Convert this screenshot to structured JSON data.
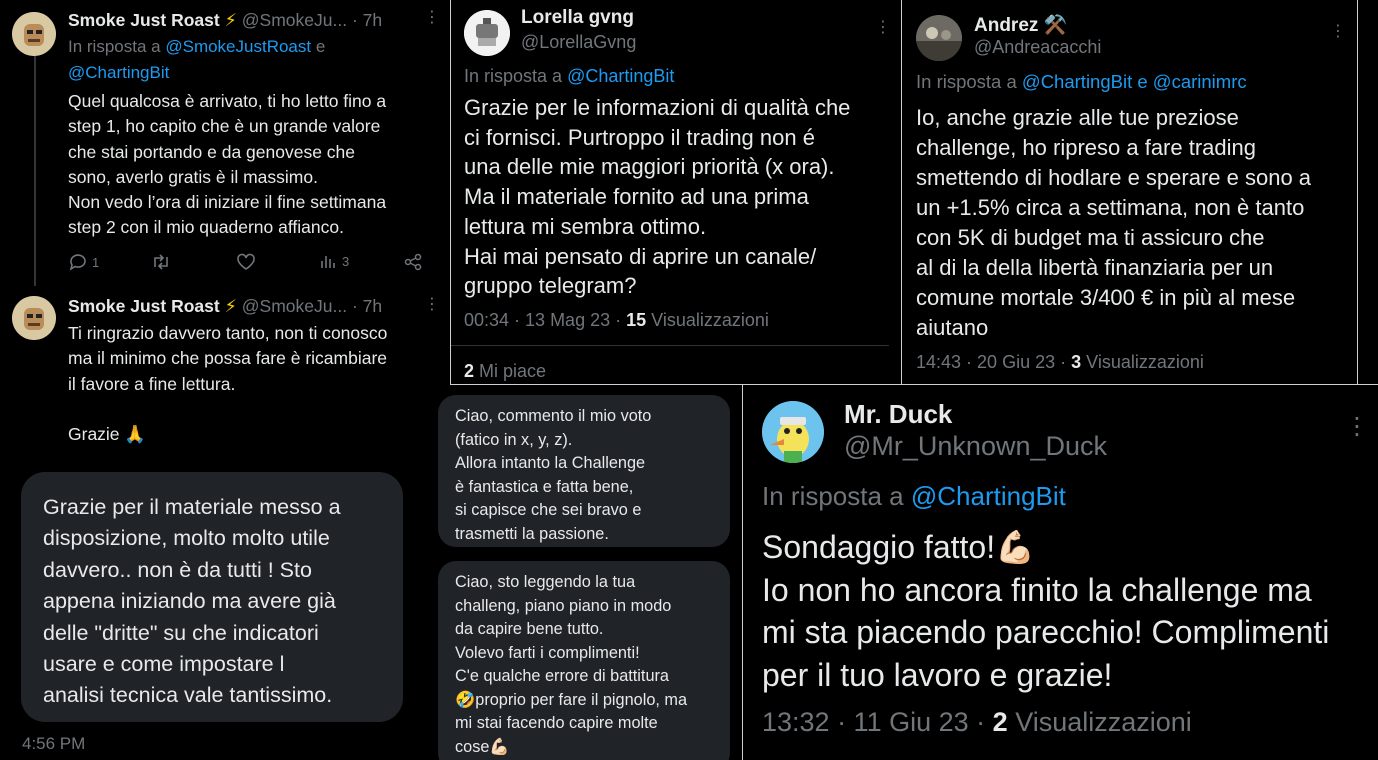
{
  "panel_a": {
    "tweet1": {
      "name": "Smoke Just Roast",
      "badge": "⚡",
      "handle": "@SmokeJu...",
      "time": "· 7h",
      "reply_prefix": "In risposta a",
      "reply_to_1": "@SmokeJustRoast",
      "reply_and": "e",
      "reply_to_2": "@ChartingBit",
      "text": "Quel qualcosa è arrivato, ti ho letto fino a\nstep 1, ho capito che è un grande valore\nche stai portando e da genovese che\nsono, averlo gratis è il massimo.\nNon vedo l’ora di iniziare il fine settimana\nstep 2 con il mio quaderno affianco.",
      "replies_count": "1",
      "views_count": "3"
    },
    "tweet2": {
      "name": "Smoke Just Roast",
      "badge": "⚡",
      "handle": "@SmokeJu...",
      "time": "· 7h",
      "text": "Ti ringrazio davvero tanto, non ti conosco\nma il minimo che possa fare è ricambiare\nil favore a fine lettura.\n\nGrazie 🙏"
    },
    "dm": {
      "text": "Grazie per il materiale messo a\ndisposizione,  molto molto utile\ndavvero.. non è da tutti ! Sto\nappena iniziando ma avere già\ndelle \"dritte\" su che indicatori\nusare e come impostare l\nanalisi tecnica vale tantissimo.",
      "time": "4:56 PM"
    }
  },
  "panel_b": {
    "name": "Lorella gvng",
    "handle": "@LorellaGvng",
    "reply_prefix": "In risposta a",
    "reply_to": "@ChartingBit",
    "text": "Grazie per le informazioni di qualità che\nci fornisci. Purtroppo il trading non é\nuna delle mie maggiori priorità (x ora).\nMa il materiale fornito ad una prima\nlettura mi sembra ottimo.\nHai mai pensato di aprire un canale/\ngruppo telegram?",
    "time": "00:34 · 13 Mag 23 ·",
    "views_num": "15",
    "views_label": "Visualizzazioni",
    "likes_num": "2",
    "likes_label": "Mi piace"
  },
  "panel_c": {
    "name": "Andrez",
    "badge": "⚒️",
    "handle": "@Andreacacchi",
    "reply_prefix": "In risposta a",
    "reply_to_1": "@ChartingBit",
    "reply_and": "e",
    "reply_to_2": "@carinimrc",
    "text": "Io, anche grazie alle tue preziose\nchallenge, ho ripreso a fare trading\nsmettendo di hodlare e sperare e sono a\nun +1.5% circa a settimana, non è tanto\ncon 5K di budget ma ti assicuro che\nal di la della libertà finanziaria per un\ncomune mortale 3/400 € in più al mese\naiutano",
    "time": "14:43 · 20 Giu 23 ·",
    "views_num": "3",
    "views_label": "Visualizzazioni"
  },
  "panel_d": {
    "msg1": "Ciao, commento il mio voto\n(fatico in x, y, z).\nAllora intanto la Challenge\nè fantastica e fatta bene,\nsi capisce che sei bravo e\ntrasmetti la passione.",
    "msg2": "Ciao, sto leggendo la tua\nchalleng, piano piano in modo\nda capire bene tutto.\nVolevo farti i complimenti!\nC'e qualche errore di battitura\n🤣proprio per fare il pignolo, ma\nmi stai facendo capire molte\ncose💪🏻"
  },
  "panel_e": {
    "name": "Mr. Duck",
    "handle": "@Mr_Unknown_Duck",
    "reply_prefix": "In risposta a",
    "reply_to": "@ChartingBit",
    "text": "Sondaggio fatto!💪🏻\nIo non ho ancora finito la challenge ma\nmi sta piacendo parecchio! Complimenti\nper il tuo lavoro e grazie!",
    "time": "13:32 · 11 Giu 23 ·",
    "views_num": "2",
    "views_label": "Visualizzazioni"
  },
  "colors": {
    "background": "#000000",
    "text": "#e7e9ea",
    "muted": "#71767b",
    "link": "#1d9bf0",
    "bubble": "#202327"
  }
}
